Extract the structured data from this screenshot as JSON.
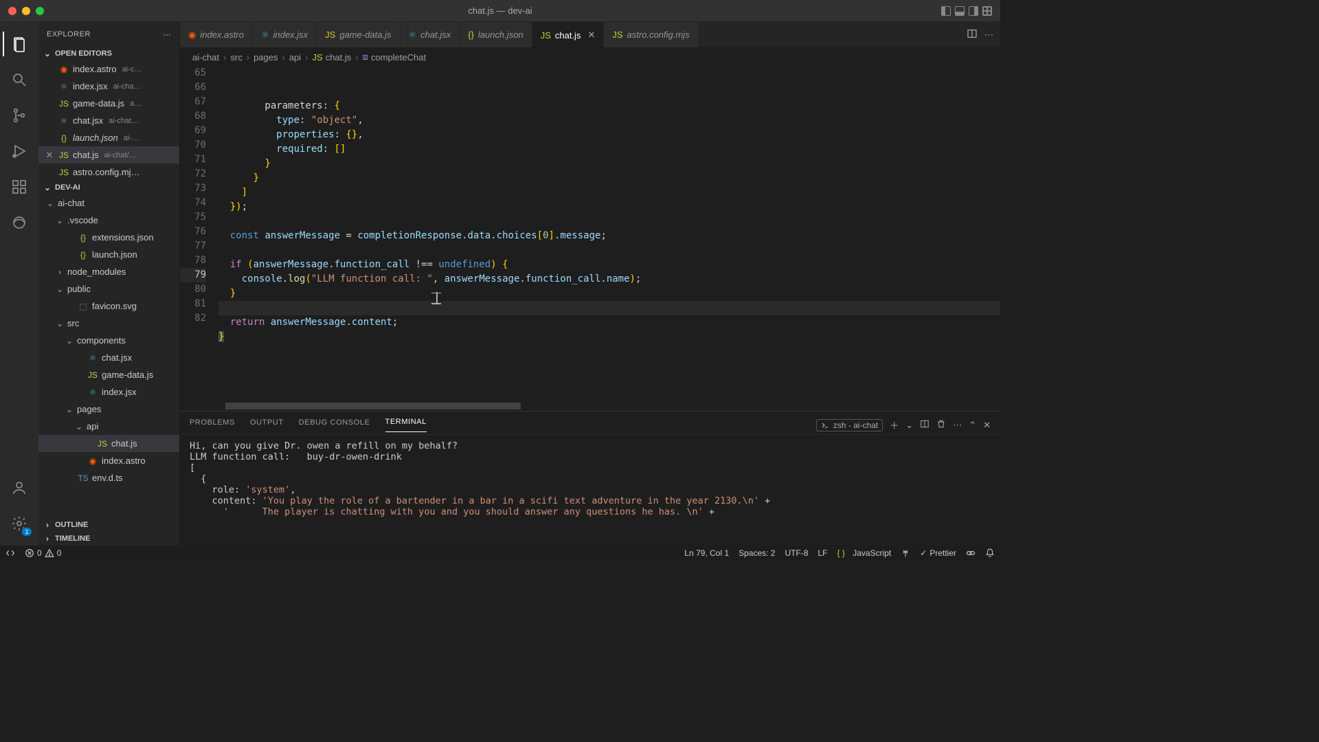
{
  "titlebar": {
    "title": "chat.js — dev-ai"
  },
  "sidebar": {
    "title": "EXPLORER",
    "sections": {
      "open_editors": "OPEN EDITORS",
      "project": "DEV-AI",
      "outline": "OUTLINE",
      "timeline": "TIMELINE"
    },
    "open_editors": [
      {
        "icon": "astro",
        "name": "index.astro",
        "desc": "ai-c…"
      },
      {
        "icon": "jsx",
        "name": "index.jsx",
        "desc": "ai-cha…"
      },
      {
        "icon": "js",
        "name": "game-data.js",
        "desc": "a…"
      },
      {
        "icon": "jsx",
        "name": "chat.jsx",
        "desc": "ai-chat…"
      },
      {
        "icon": "json",
        "name": "launch.json",
        "desc": "ai-…",
        "italic": true
      },
      {
        "icon": "js",
        "name": "chat.js",
        "desc": "ai-chat/…",
        "active": true
      },
      {
        "icon": "js",
        "name": "astro.config.mj…",
        "desc": ""
      }
    ],
    "tree": [
      {
        "depth": 0,
        "chev": "⌄",
        "name": "ai-chat",
        "folder": true
      },
      {
        "depth": 1,
        "chev": "⌄",
        "name": ".vscode",
        "folder": true
      },
      {
        "depth": 2,
        "icon": "json",
        "name": "extensions.json"
      },
      {
        "depth": 2,
        "icon": "json",
        "name": "launch.json"
      },
      {
        "depth": 1,
        "chev": "›",
        "name": "node_modules",
        "folder": true
      },
      {
        "depth": 1,
        "chev": "⌄",
        "name": "public",
        "folder": true
      },
      {
        "depth": 2,
        "icon": "svg",
        "name": "favicon.svg"
      },
      {
        "depth": 1,
        "chev": "⌄",
        "name": "src",
        "folder": true
      },
      {
        "depth": 2,
        "chev": "⌄",
        "name": "components",
        "folder": true
      },
      {
        "depth": 3,
        "icon": "jsx",
        "name": "chat.jsx"
      },
      {
        "depth": 3,
        "icon": "js",
        "name": "game-data.js"
      },
      {
        "depth": 3,
        "icon": "jsx",
        "name": "index.jsx"
      },
      {
        "depth": 2,
        "chev": "⌄",
        "name": "pages",
        "folder": true
      },
      {
        "depth": 3,
        "chev": "⌄",
        "name": "api",
        "folder": true
      },
      {
        "depth": 4,
        "icon": "js",
        "name": "chat.js",
        "active": true
      },
      {
        "depth": 3,
        "icon": "astro",
        "name": "index.astro"
      },
      {
        "depth": 2,
        "icon": "ts",
        "name": "env.d.ts"
      }
    ]
  },
  "tabs": [
    {
      "icon": "astro",
      "label": "index.astro"
    },
    {
      "icon": "jsx",
      "label": "index.jsx"
    },
    {
      "icon": "js",
      "label": "game-data.js"
    },
    {
      "icon": "jsx",
      "label": "chat.jsx"
    },
    {
      "icon": "json",
      "label": "launch.json",
      "italic": true
    },
    {
      "icon": "js",
      "label": "chat.js",
      "active": true,
      "closable": true
    },
    {
      "icon": "js",
      "label": "astro.config.mjs"
    }
  ],
  "breadcrumbs": [
    {
      "text": "ai-chat"
    },
    {
      "text": "src"
    },
    {
      "text": "pages"
    },
    {
      "text": "api"
    },
    {
      "text": "chat.js",
      "icon": "js"
    },
    {
      "text": "completeChat",
      "icon": "fn"
    }
  ],
  "code": {
    "lines": [
      {
        "n": 65,
        "html": "        parameters<span class='op'>:</span> <span class='punc'>{</span>"
      },
      {
        "n": 66,
        "html": "          <span class='prop'>type</span><span class='op'>:</span> <span class='str'>\"object\"</span><span class='op'>,</span>"
      },
      {
        "n": 67,
        "html": "          <span class='prop'>properties</span><span class='op'>:</span> <span class='punc'>{}</span><span class='op'>,</span>"
      },
      {
        "n": 68,
        "html": "          <span class='prop'>required</span><span class='op'>:</span> <span class='punc'>[]</span>"
      },
      {
        "n": 69,
        "html": "        <span class='punc'>}</span>"
      },
      {
        "n": 70,
        "html": "      <span class='punc'>}</span>"
      },
      {
        "n": 71,
        "html": "    <span class='punc'>]</span>"
      },
      {
        "n": 72,
        "html": "  <span class='punc'>})</span><span class='op'>;</span>"
      },
      {
        "n": 73,
        "html": ""
      },
      {
        "n": 74,
        "html": "  <span class='kw2'>const</span> <span class='var'>answerMessage</span> <span class='op'>=</span> <span class='var'>completionResponse</span><span class='op'>.</span><span class='var'>data</span><span class='op'>.</span><span class='var'>choices</span><span class='punc'>[</span><span class='num'>0</span><span class='punc'>]</span><span class='op'>.</span><span class='var'>message</span><span class='op'>;</span>"
      },
      {
        "n": 75,
        "html": ""
      },
      {
        "n": 76,
        "html": "  <span class='kw'>if</span> <span class='punc'>(</span><span class='var'>answerMessage</span><span class='op'>.</span><span class='var'>function_call</span> <span class='op'>!==</span> <span class='kw2'>undefined</span><span class='punc'>)</span> <span class='punc'>{</span>"
      },
      {
        "n": 77,
        "html": "    <span class='var'>console</span><span class='op'>.</span><span class='fn'>log</span><span class='punc'>(</span><span class='str'>\"LLM function call: \"</span><span class='op'>,</span> <span class='var'>answerMessage</span><span class='op'>.</span><span class='var'>function_call</span><span class='op'>.</span><span class='var'>name</span><span class='punc'>)</span><span class='op'>;</span>"
      },
      {
        "n": 78,
        "html": "  <span class='punc'>}</span>"
      },
      {
        "n": 79,
        "html": "",
        "current": true
      },
      {
        "n": 80,
        "html": "  <span class='kw'>return</span> <span class='var'>answerMessage</span><span class='op'>.</span><span class='var'>content</span><span class='op'>;</span>"
      },
      {
        "n": 81,
        "html": "<span class='punc' style='background:#484848'>}</span>"
      },
      {
        "n": 82,
        "html": ""
      }
    ]
  },
  "panel": {
    "tabs": {
      "problems": "PROBLEMS",
      "output": "OUTPUT",
      "debug": "DEBUG CONSOLE",
      "terminal": "TERMINAL"
    },
    "shell": "zsh - ai-chat",
    "lines": [
      "Hi, can you give Dr. owen a refill on my behalf?",
      "LLM function call:   buy-dr-owen-drink",
      "[",
      "  {",
      "    role: <span class='str'>'system'</span>,",
      "    content: <span class='str'>'You play the role of a bartender in a bar in a scifi text adventure in the year 2130.\\n'</span> +",
      "      <span class='str'>'      The player is chatting with you and you should answer any questions he has. \\n'</span> +"
    ]
  },
  "statusbar": {
    "errors": "0",
    "warnings": "0",
    "ln": "Ln 79, Col 1",
    "spaces": "Spaces: 2",
    "enc": "UTF-8",
    "eol": "LF",
    "lang": "JavaScript",
    "prettier": "Prettier"
  }
}
